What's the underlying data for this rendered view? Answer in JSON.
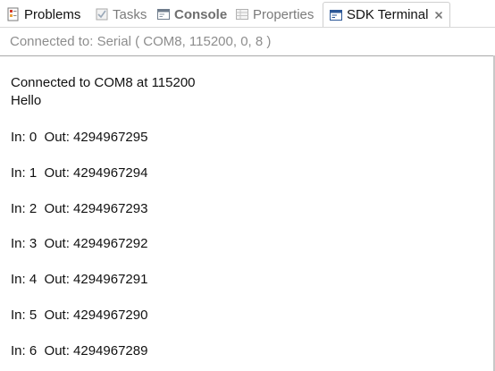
{
  "tabs": [
    {
      "label": "Problems",
      "icon": "problems-icon"
    },
    {
      "label": "Tasks",
      "icon": "tasks-icon"
    },
    {
      "label": "Console",
      "icon": "console-icon"
    },
    {
      "label": "Properties",
      "icon": "properties-icon"
    },
    {
      "label": "SDK Terminal",
      "icon": "sdk-terminal-icon",
      "active": true
    }
  ],
  "status": {
    "text": "Connected to: Serial (  COM8, 115200, 0, 8 )"
  },
  "terminal": {
    "lines": [
      "Connected to COM8 at 115200",
      "Hello",
      "In: 0  Out: 4294967295",
      "In: 1  Out: 4294967294",
      "In: 2  Out: 4294967293",
      "In: 3  Out: 4294967292",
      "In: 4  Out: 4294967291",
      "In: 5  Out: 4294967290",
      "In: 6  Out: 4294967289"
    ]
  },
  "colors": {
    "accent_blue": "#2b5797",
    "inactive_text": "#7b7b7b",
    "terminal_text": "#111111"
  }
}
